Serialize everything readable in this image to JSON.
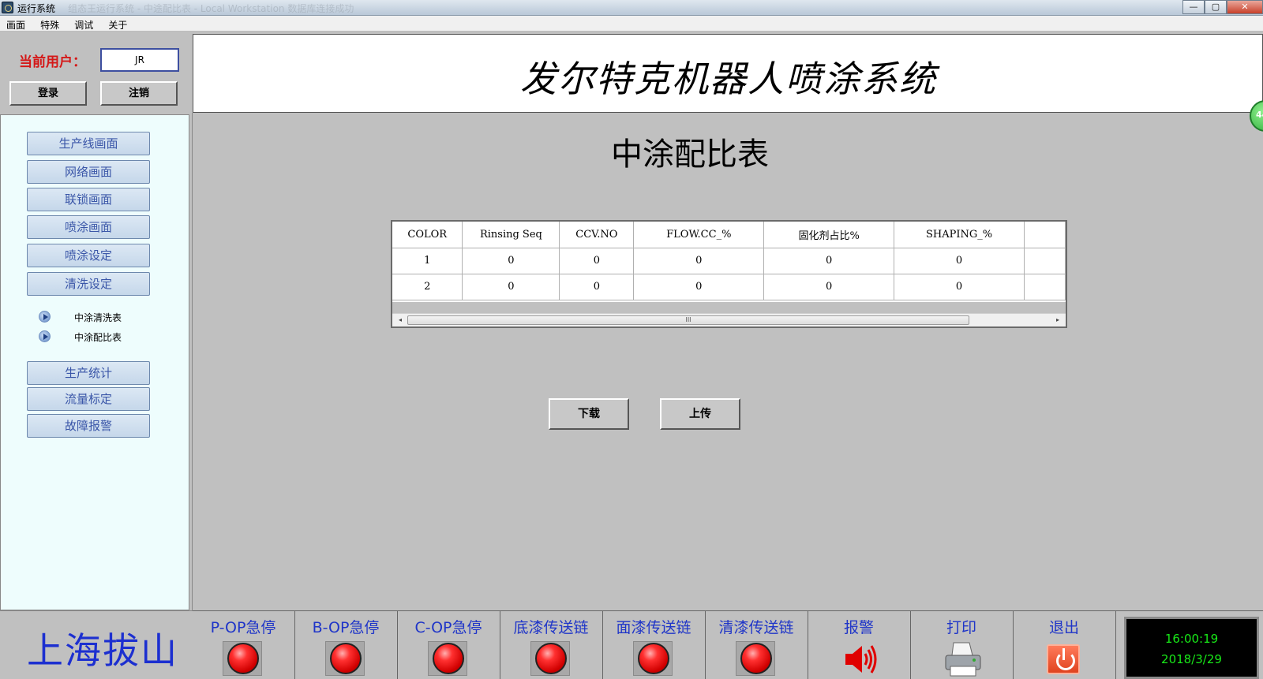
{
  "window": {
    "title": "运行系统",
    "ghost_text": "组态王运行系统 - 中途配比表 - Local Workstation 数据库连接成功",
    "btn_min": "—",
    "btn_max": "▢",
    "btn_close": "✕"
  },
  "menu": [
    "画面",
    "特殊",
    "调试",
    "关于"
  ],
  "user": {
    "label": "当前用户：",
    "value": "JR",
    "login": "登录",
    "logout": "注销"
  },
  "header": {
    "title": "发尔特克机器人喷涂系统"
  },
  "nav": {
    "items": [
      "生产线画面",
      "网络画面",
      "联锁画面",
      "喷涂画面",
      "喷涂设定",
      "清洗设定"
    ],
    "sub_items": [
      "中涂清洗表",
      "中涂配比表"
    ],
    "items2": [
      "生产统计",
      "流量标定",
      "故障报警"
    ]
  },
  "page": {
    "title": "中涂配比表"
  },
  "table": {
    "columns": [
      "COLOR",
      "Rinsing Seq",
      "CCV.NO",
      "FLOW.CC_%",
      "固化剂占比%",
      "SHAPING_%",
      ""
    ],
    "rows": [
      [
        "1",
        "0",
        "0",
        "0",
        "0",
        "0",
        ""
      ],
      [
        "2",
        "0",
        "0",
        "0",
        "0",
        "0",
        ""
      ]
    ],
    "scroll_grip": "III",
    "scroll_left": "◂",
    "scroll_right": "▸"
  },
  "actions": {
    "download": "下载",
    "upload": "上传"
  },
  "edge_badge": "44",
  "logo": "上海拔山",
  "bottom": {
    "cells": [
      "P-OP急停",
      "B-OP急停",
      "C-OP急停",
      "底漆传送链",
      "面漆传送链",
      "清漆传送链",
      "报警",
      "打印",
      "退出"
    ]
  },
  "clock": {
    "time": "16:00:19",
    "date": "2018/3/29"
  },
  "colors": {
    "label_blue": "#1f35c8",
    "user_label_red": "#d41818",
    "lamp_red": "#ff3030",
    "clock_green": "#18e818"
  },
  "icons": {
    "alarm": "speaker-icon",
    "print": "printer-icon",
    "exit": "power-icon"
  }
}
